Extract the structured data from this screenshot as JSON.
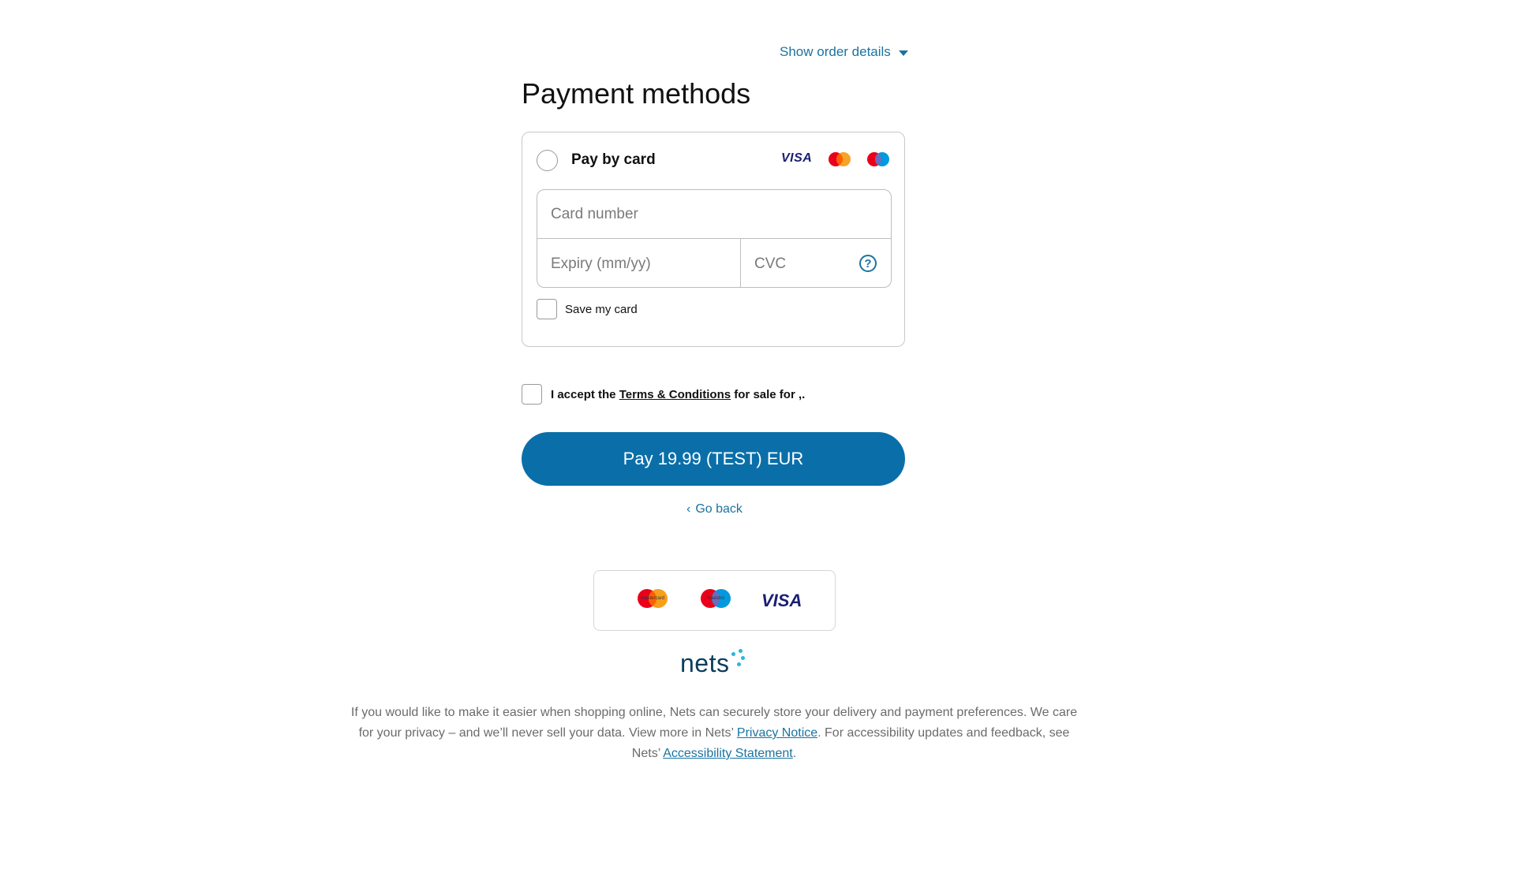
{
  "header": {
    "order_toggle": "Show order details",
    "title": "Payment methods"
  },
  "payment_method": {
    "label": "Pay by card",
    "card_number_placeholder": "Card number",
    "expiry_placeholder": "Expiry (mm/yy)",
    "cvc_placeholder": "CVC",
    "help_glyph": "?",
    "save_card_label": "Save my card",
    "brand_visa": "VISA"
  },
  "terms": {
    "prefix": "I accept the ",
    "link": "Terms & Conditions",
    "suffix": " for sale for ,."
  },
  "pay_button_label": "Pay 19.99 (TEST) EUR",
  "go_back_label": "Go back",
  "brands": {
    "mastercard_caption": "mastercard",
    "maestro_caption": "maestro",
    "visa": "VISA"
  },
  "nets_logo_text": "nets",
  "footer": {
    "text_1": "If you would like to make it easier when shopping online, Nets can securely store your delivery and payment preferences. We care for your privacy – and we’ll never sell your data. View more in Nets’ ",
    "privacy_link": "Privacy Notice",
    "text_2": ". For accessibility updates and feedback, see Nets’ ",
    "accessibility_link": "Accessibility Statement",
    "text_3": "."
  },
  "colors": {
    "primary_blue": "#0a6fa9",
    "link_blue": "#1a73a0",
    "mastercard_red": "#eb001b",
    "mastercard_orange": "#f79e1b",
    "maestro_blue": "#0099df",
    "visa_navy": "#1a1f71",
    "nets_dots": "#29b6d9"
  },
  "icons": [
    "caret-down-icon",
    "help-icon",
    "chevron-left-icon",
    "visa-logo",
    "mastercard-logo",
    "maestro-logo",
    "nets-logo"
  ]
}
